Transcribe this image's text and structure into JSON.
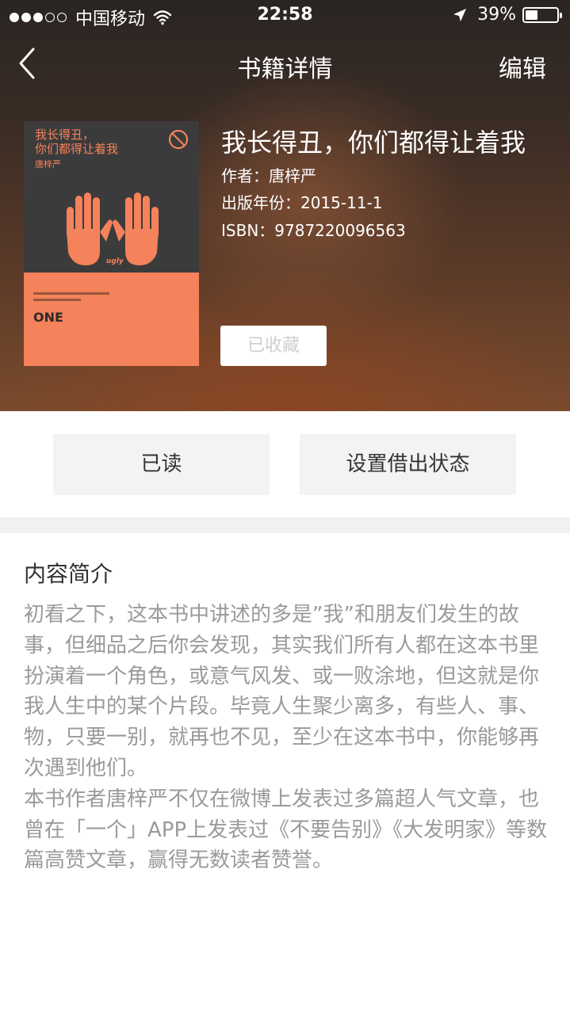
{
  "status_bar": {
    "carrier": "中国移动",
    "time": "22:58",
    "battery_percent": "39%",
    "battery_level": 0.39,
    "signal_dots_filled": 3,
    "signal_dots_total": 5
  },
  "nav": {
    "title": "书籍详情",
    "edit_label": "编辑",
    "back_icon": "chevron-left-icon"
  },
  "book": {
    "title": "我长得丑，你们都得让着我",
    "author_line": "作者：唐梓严",
    "year_line": "出版年份：2015-11-1",
    "isbn_line": "ISBN：9787220096563",
    "collected_label": "已收藏",
    "cover": {
      "title_line1": "我长得丑，",
      "title_line2": "你们都得让着我",
      "author": "唐梓严",
      "ugly_label": "ugly",
      "one_label": "ONE",
      "accent_color": "#f4825a",
      "dark_color": "#3c3b3c"
    }
  },
  "actions": {
    "read_label": "已读",
    "lend_label": "设置借出状态"
  },
  "intro": {
    "heading": "内容简介",
    "body": "初看之下，这本书中讲述的多是”我”和朋友们发生的故事，但细品之后你会发现，其实我们所有人都在这本书里扮演着一个角色，或意气风发、或一败涂地，但这就是你我人生中的某个片段。毕竟人生聚少离多，有些人、事、物，只要一别，就再也不见，至少在这本书中，你能够再次遇到他们。\n本书作者唐梓严不仅在微博上发表过多篇超人气文章，也曾在「一个」APP上发表过《不要告别》《大发明家》等数篇高赞文章，赢得无数读者赞誉。"
  }
}
